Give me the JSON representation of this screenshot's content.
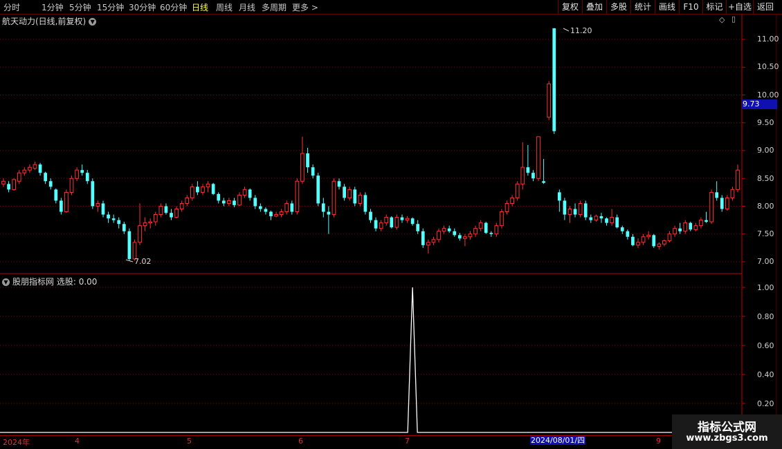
{
  "toolbar": {
    "periods": [
      "分时",
      "1分钟",
      "5分钟",
      "15分钟",
      "30分钟",
      "60分钟",
      "日线",
      "周线",
      "月线",
      "多周期",
      "更多 >"
    ],
    "active_period": "日线",
    "tools": [
      "复权",
      "叠加",
      "多股",
      "统计",
      "画线",
      "F10",
      "标记",
      "+自选",
      "返回"
    ]
  },
  "chart_title": "航天动力(日线,前复权)",
  "indicator_title": "股朋指标网",
  "indicator_value_label": "选股: 0.00",
  "price_axis": [
    "11.00",
    "10.50",
    "10.00",
    "9.50",
    "9.00",
    "8.50",
    "8.00",
    "7.50",
    "7.00"
  ],
  "current_price": "9.73",
  "annotations": {
    "high": "11.20",
    "low": "7.02"
  },
  "indicator_axis": [
    "1.00",
    "0.80",
    "0.60",
    "0.40",
    "0.20"
  ],
  "date_axis": [
    "2024年",
    "4",
    "5",
    "6",
    "7",
    "2024/08/01/四",
    "9"
  ],
  "watermark": {
    "title": "指标公式网",
    "url": "www.zbgs3.com"
  },
  "colors": {
    "up": "#ff3232",
    "down": "#54ffff",
    "grid": "#8a0000",
    "axis_border": "#c00000",
    "current_bg": "#1010b0"
  },
  "chart_data": [
    {
      "type": "candlestick",
      "title": "航天动力(日线,前复权)",
      "ylim": [
        7.0,
        11.2
      ],
      "high_label": 11.2,
      "low_label": 7.02,
      "last": 9.73,
      "ohlc": [
        [
          8.4,
          8.5,
          8.35,
          8.45
        ],
        [
          8.4,
          8.45,
          8.25,
          8.3
        ],
        [
          8.3,
          8.5,
          8.28,
          8.48
        ],
        [
          8.45,
          8.65,
          8.4,
          8.6
        ],
        [
          8.6,
          8.7,
          8.55,
          8.65
        ],
        [
          8.65,
          8.75,
          8.6,
          8.7
        ],
        [
          8.68,
          8.8,
          8.65,
          8.75
        ],
        [
          8.75,
          8.78,
          8.55,
          8.6
        ],
        [
          8.6,
          8.62,
          8.4,
          8.45
        ],
        [
          8.45,
          8.5,
          8.3,
          8.35
        ],
        [
          8.3,
          8.32,
          8.05,
          8.1
        ],
        [
          8.1,
          8.15,
          7.85,
          7.9
        ],
        [
          7.9,
          8.3,
          7.88,
          8.25
        ],
        [
          8.25,
          8.55,
          8.2,
          8.5
        ],
        [
          8.5,
          8.7,
          8.45,
          8.65
        ],
        [
          8.65,
          8.75,
          8.55,
          8.6
        ],
        [
          8.6,
          8.65,
          8.4,
          8.45
        ],
        [
          8.45,
          8.5,
          7.95,
          8.0
        ],
        [
          8.0,
          8.1,
          7.9,
          8.05
        ],
        [
          8.05,
          8.1,
          7.8,
          7.85
        ],
        [
          7.85,
          7.9,
          7.7,
          7.78
        ],
        [
          7.78,
          7.85,
          7.7,
          7.75
        ],
        [
          7.75,
          7.8,
          7.6,
          7.68
        ],
        [
          7.68,
          7.72,
          7.5,
          7.55
        ],
        [
          7.55,
          7.6,
          7.02,
          7.05
        ],
        [
          7.05,
          7.4,
          7.02,
          7.35
        ],
        [
          7.35,
          8.05,
          7.3,
          7.65
        ],
        [
          7.65,
          7.8,
          7.55,
          7.7
        ],
        [
          7.7,
          7.78,
          7.6,
          7.72
        ],
        [
          7.72,
          7.9,
          7.65,
          7.85
        ],
        [
          7.85,
          8.05,
          7.8,
          8.0
        ],
        [
          8.0,
          8.05,
          7.85,
          7.88
        ],
        [
          7.88,
          7.95,
          7.75,
          7.8
        ],
        [
          7.8,
          8.0,
          7.78,
          7.95
        ],
        [
          7.95,
          8.1,
          7.9,
          8.05
        ],
        [
          8.05,
          8.2,
          8.0,
          8.15
        ],
        [
          8.15,
          8.4,
          8.1,
          8.35
        ],
        [
          8.35,
          8.45,
          8.2,
          8.25
        ],
        [
          8.25,
          8.4,
          8.2,
          8.35
        ],
        [
          8.35,
          8.45,
          8.25,
          8.4
        ],
        [
          8.4,
          8.42,
          8.2,
          8.22
        ],
        [
          8.22,
          8.25,
          8.05,
          8.1
        ],
        [
          8.1,
          8.15,
          8.0,
          8.05
        ],
        [
          8.05,
          8.15,
          8.0,
          8.1
        ],
        [
          8.1,
          8.15,
          7.98,
          8.02
        ],
        [
          8.02,
          8.25,
          8.0,
          8.2
        ],
        [
          8.2,
          8.35,
          8.15,
          8.3
        ],
        [
          8.3,
          8.32,
          8.1,
          8.15
        ],
        [
          8.15,
          8.2,
          7.95,
          8.0
        ],
        [
          8.0,
          8.05,
          7.9,
          7.95
        ],
        [
          7.95,
          7.98,
          7.85,
          7.9
        ],
        [
          7.9,
          7.92,
          7.75,
          7.82
        ],
        [
          7.82,
          7.9,
          7.8,
          7.85
        ],
        [
          7.85,
          7.95,
          7.8,
          7.9
        ],
        [
          7.9,
          8.1,
          7.85,
          8.05
        ],
        [
          8.05,
          8.1,
          7.85,
          7.9
        ],
        [
          7.9,
          8.5,
          7.85,
          8.45
        ],
        [
          8.45,
          9.25,
          8.4,
          8.95
        ],
        [
          8.95,
          9.05,
          8.6,
          8.7
        ],
        [
          8.7,
          8.75,
          8.5,
          8.55
        ],
        [
          8.55,
          8.6,
          8.0,
          8.05
        ],
        [
          8.05,
          8.15,
          7.8,
          7.9
        ],
        [
          7.9,
          8.0,
          7.5,
          7.85
        ],
        [
          7.85,
          8.5,
          7.8,
          8.45
        ],
        [
          8.45,
          8.5,
          8.3,
          8.35
        ],
        [
          8.35,
          8.4,
          8.1,
          8.15
        ],
        [
          8.15,
          8.35,
          8.1,
          8.3
        ],
        [
          8.3,
          8.35,
          8.0,
          8.05
        ],
        [
          8.05,
          8.25,
          8.0,
          8.2
        ],
        [
          8.2,
          8.25,
          7.85,
          7.9
        ],
        [
          7.9,
          7.95,
          7.7,
          7.75
        ],
        [
          7.75,
          7.8,
          7.55,
          7.6
        ],
        [
          7.6,
          7.75,
          7.55,
          7.7
        ],
        [
          7.7,
          7.85,
          7.65,
          7.8
        ],
        [
          7.8,
          7.82,
          7.6,
          7.62
        ],
        [
          7.62,
          7.85,
          7.58,
          7.8
        ],
        [
          7.8,
          7.85,
          7.7,
          7.75
        ],
        [
          7.75,
          7.82,
          7.7,
          7.78
        ],
        [
          7.78,
          7.8,
          7.65,
          7.68
        ],
        [
          7.68,
          7.75,
          7.5,
          7.55
        ],
        [
          7.55,
          7.6,
          7.25,
          7.3
        ],
        [
          7.3,
          7.4,
          7.15,
          7.35
        ],
        [
          7.35,
          7.45,
          7.3,
          7.4
        ],
        [
          7.4,
          7.6,
          7.35,
          7.55
        ],
        [
          7.55,
          7.65,
          7.5,
          7.6
        ],
        [
          7.6,
          7.65,
          7.52,
          7.55
        ],
        [
          7.55,
          7.6,
          7.45,
          7.48
        ],
        [
          7.48,
          7.52,
          7.38,
          7.42
        ],
        [
          7.42,
          7.5,
          7.28,
          7.45
        ],
        [
          7.45,
          7.55,
          7.4,
          7.5
        ],
        [
          7.5,
          7.65,
          7.45,
          7.6
        ],
        [
          7.6,
          7.75,
          7.55,
          7.7
        ],
        [
          7.7,
          7.72,
          7.5,
          7.52
        ],
        [
          7.52,
          7.55,
          7.45,
          7.5
        ],
        [
          7.5,
          7.7,
          7.45,
          7.65
        ],
        [
          7.65,
          7.95,
          7.6,
          7.9
        ],
        [
          7.9,
          8.1,
          7.85,
          8.05
        ],
        [
          8.05,
          8.2,
          8.0,
          8.15
        ],
        [
          8.15,
          8.45,
          8.1,
          8.4
        ],
        [
          8.4,
          9.15,
          8.3,
          8.7
        ],
        [
          8.7,
          9.1,
          8.55,
          8.6
        ],
        [
          8.6,
          8.65,
          8.45,
          8.5
        ],
        [
          8.5,
          9.25,
          8.45,
          9.25
        ],
        [
          8.45,
          8.85,
          8.4,
          8.42
        ],
        [
          9.6,
          10.25,
          9.55,
          10.2
        ],
        [
          11.2,
          11.2,
          9.3,
          9.35
        ],
        [
          8.25,
          8.3,
          7.9,
          8.1
        ],
        [
          8.1,
          8.15,
          7.75,
          7.85
        ],
        [
          7.85,
          8.0,
          7.7,
          7.95
        ],
        [
          7.95,
          8.05,
          7.8,
          7.85
        ],
        [
          7.85,
          8.1,
          7.8,
          8.05
        ],
        [
          8.05,
          8.1,
          7.75,
          7.8
        ],
        [
          7.8,
          7.85,
          7.7,
          7.75
        ],
        [
          7.75,
          7.85,
          7.72,
          7.82
        ],
        [
          7.82,
          7.88,
          7.7,
          7.78
        ],
        [
          7.78,
          7.8,
          7.65,
          7.7
        ],
        [
          7.7,
          7.95,
          7.65,
          7.8
        ],
        [
          7.8,
          7.85,
          7.6,
          7.62
        ],
        [
          7.62,
          7.65,
          7.5,
          7.55
        ],
        [
          7.55,
          7.58,
          7.4,
          7.45
        ],
        [
          7.45,
          7.5,
          7.28,
          7.3
        ],
        [
          7.3,
          7.42,
          7.25,
          7.35
        ],
        [
          7.35,
          7.5,
          7.3,
          7.45
        ],
        [
          7.45,
          7.55,
          7.4,
          7.48
        ],
        [
          7.48,
          7.5,
          7.25,
          7.28
        ],
        [
          7.28,
          7.35,
          7.22,
          7.32
        ],
        [
          7.32,
          7.4,
          7.28,
          7.38
        ],
        [
          7.38,
          7.55,
          7.35,
          7.5
        ],
        [
          7.5,
          7.65,
          7.45,
          7.6
        ],
        [
          7.6,
          7.7,
          7.5,
          7.55
        ],
        [
          7.55,
          7.75,
          7.5,
          7.7
        ],
        [
          7.7,
          7.72,
          7.55,
          7.58
        ],
        [
          7.58,
          7.7,
          7.55,
          7.65
        ],
        [
          7.65,
          7.8,
          7.6,
          7.75
        ],
        [
          7.75,
          7.9,
          7.7,
          7.72
        ],
        [
          7.72,
          8.3,
          7.68,
          8.25
        ],
        [
          8.25,
          8.45,
          8.1,
          8.15
        ],
        [
          8.15,
          8.2,
          7.9,
          7.95
        ],
        [
          7.95,
          8.2,
          7.92,
          8.15
        ],
        [
          8.15,
          8.35,
          8.1,
          8.3
        ],
        [
          8.3,
          8.75,
          8.25,
          8.65
        ]
      ]
    },
    {
      "type": "line",
      "title": "股朋指标网",
      "series": [
        {
          "name": "选股",
          "values_description": "all zero except one spike",
          "values": []
        }
      ],
      "spike_index": 78,
      "spike_value": 1.0,
      "ylim": [
        0.0,
        1.0
      ],
      "last": 0.0
    }
  ]
}
